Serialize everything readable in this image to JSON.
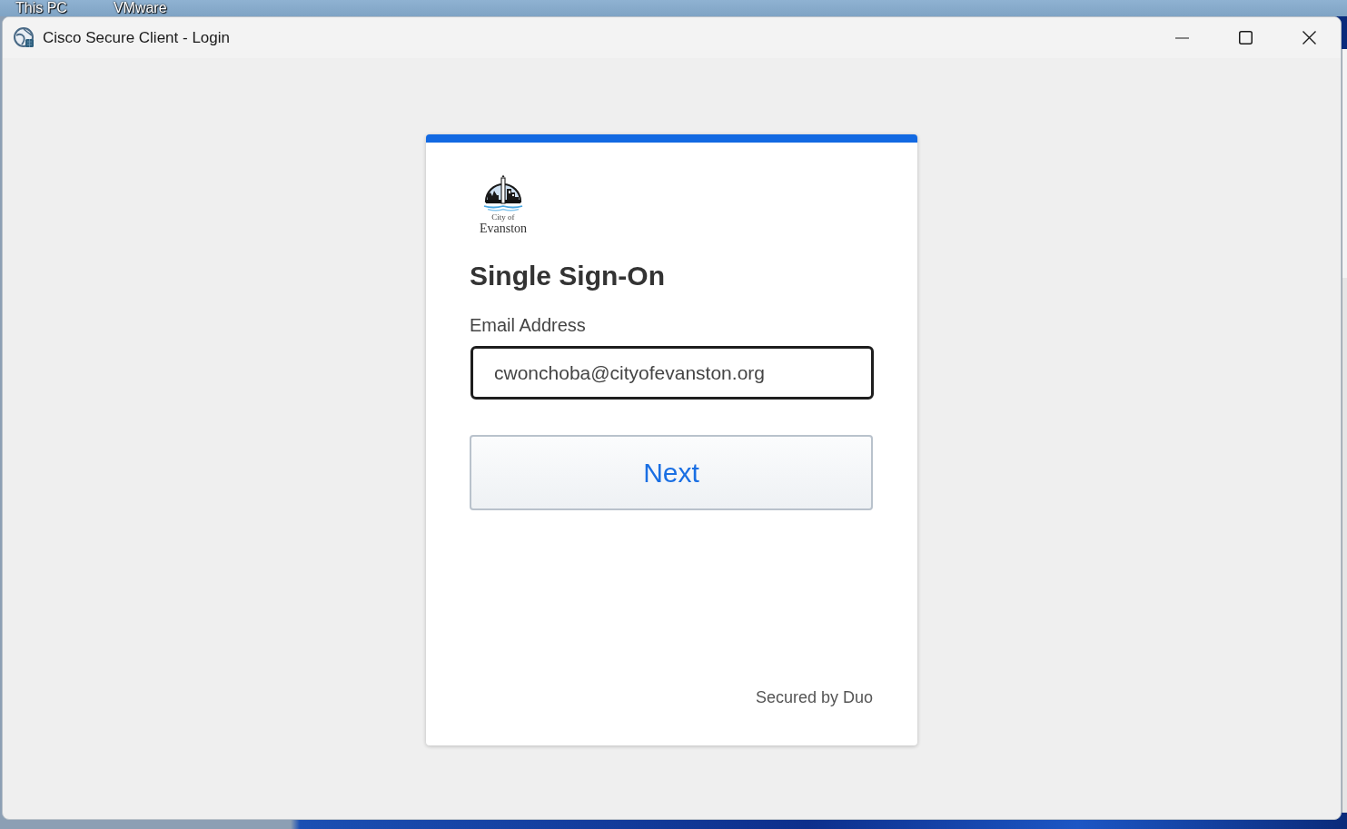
{
  "desktop": {
    "icons": [
      {
        "label": "This PC"
      },
      {
        "label": "VMware"
      }
    ]
  },
  "window": {
    "title": "Cisco Secure Client - Login"
  },
  "sign_on": {
    "logo": {
      "lines": [
        "City of",
        "Evanston"
      ]
    },
    "heading": "Single Sign-On",
    "email_field": {
      "label": "Email Address",
      "value": "cwonchoba@cityofevanston.org",
      "focused": true
    },
    "next_button": {
      "label": "Next"
    },
    "footer": "Secured by Duo"
  }
}
